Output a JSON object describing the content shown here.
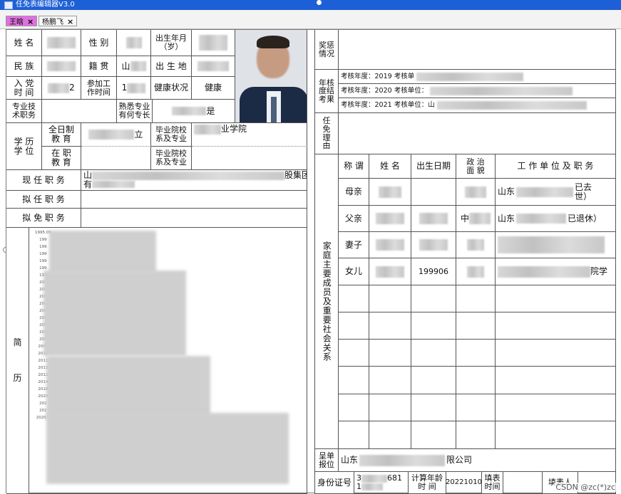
{
  "window": {
    "title": "任免表编辑器V3.0"
  },
  "tabs": [
    {
      "label": "王晗",
      "close": "×"
    },
    {
      "label": "杨鹏飞",
      "close": "×"
    }
  ],
  "left": {
    "row1": {
      "name_label": "姓 名",
      "gender_label": "性 别",
      "birth_label": "出生年月\n（岁）"
    },
    "row2": {
      "ethnic_label": "民 族",
      "native_label": "籍 贯",
      "native_value": "山",
      "birthplace_label": "出 生 地"
    },
    "row3": {
      "party_label": "入 党\n时 间",
      "party_value": "2",
      "work_label": "参加工\n作时间",
      "work_value": "1",
      "health_label": "健康状况",
      "health_value": "健康"
    },
    "row4": {
      "title_label": "专业技\n术职务",
      "skill_label": "熟悉专业\n有何专长",
      "skill_value": "是"
    },
    "edu": {
      "label": "学 历\n学 位",
      "fulltime": "全日制\n教 育",
      "fulltime_value": "立",
      "school_label1": "毕业院校\n系及专业",
      "school_value1": "业学院",
      "parttime": "在 职\n教 育",
      "school_label2": "毕业院校\n系及专业"
    },
    "current_post_label": "现 任 职 务",
    "current_post_value": "山",
    "current_post_value2": "有",
    "current_post_tail": "股集团",
    "proposed_post_label": "拟 任 职 务",
    "proposed_remove_label": "拟 免 职 务",
    "resume_label": "简\n\n\n\n历",
    "resume_years": [
      "1995.09",
      "199",
      "199",
      "199",
      "199",
      "199",
      "199",
      "200",
      "200",
      "200",
      "200",
      "200",
      "200",
      "200",
      "200",
      "200",
      "2007",
      "2011",
      "2011",
      "2013",
      "2012",
      "2014",
      "2018",
      "2020",
      "202",
      "202",
      "2020.1"
    ]
  },
  "right": {
    "awards_label": "奖惩\n情况",
    "appraisal_label": "年核\n度结\n考果",
    "appraisal_rows": [
      "考核年度：2019 考核单",
      "考核年度：2020 考核单位：",
      "考核年度：2021 考核单位：山"
    ],
    "removal_reason_label": "任\n免\n理\n由",
    "family_label": "家庭主要成员及重要社会关系",
    "family_headers": [
      "称 谓",
      "姓 名",
      "出生日期",
      "政 治\n面 貌",
      "工 作 单 位 及 职 务"
    ],
    "family_rows": [
      {
        "relation": "母亲",
        "birth": "",
        "unit": "山东",
        "unit_tail": "已去\n世）"
      },
      {
        "relation": "父亲",
        "birth": "",
        "party": "中",
        "unit": "山东",
        "unit_tail": "已退休）"
      },
      {
        "relation": "妻子",
        "birth": "",
        "unit": "",
        "unit_tail": ""
      },
      {
        "relation": "女儿",
        "birth": "199906",
        "unit": "",
        "unit_tail": "院学"
      }
    ],
    "report_unit_label": "呈单\n报位",
    "report_unit_value": "山东",
    "report_unit_tail": "限公司"
  },
  "footer": {
    "id_label": "身份证号",
    "id_value_start": "3",
    "id_value_line2": "1",
    "id_value_mid": "681",
    "calc_age_label": "计算年龄\n时 间",
    "calc_age_value": "20221010",
    "fill_time_label": "填表\n时间",
    "filler_label": "填表人",
    "watermark": "CSDN @zc(*)zc"
  }
}
